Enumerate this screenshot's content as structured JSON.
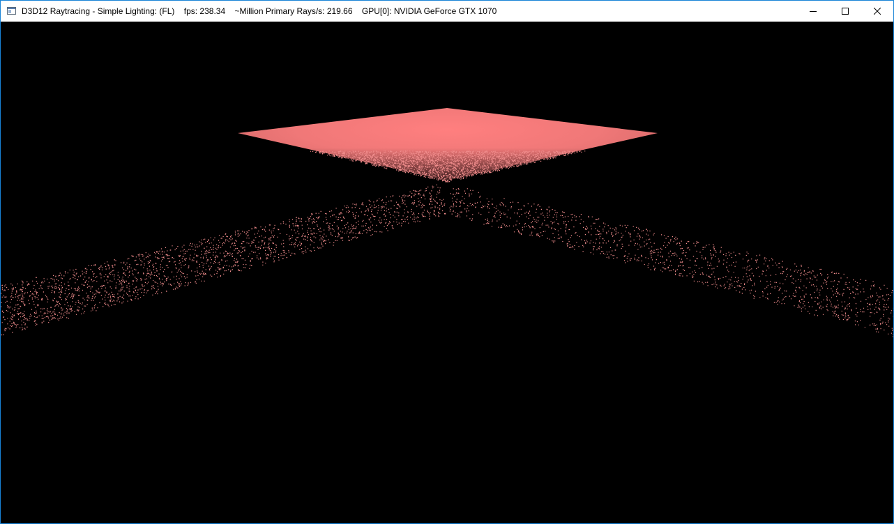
{
  "window": {
    "title": "D3D12 Raytracing - Simple Lighting: (FL)    fps: 238.34    ~Million Primary Rays/s: 219.66    GPU[0]: NVIDIA GeForce GTX 1070",
    "app_icon": "window-app-icon",
    "controls": {
      "minimize_icon": "minimize-icon",
      "maximize_icon": "maximize-icon",
      "close_icon": "close-icon"
    }
  },
  "scene": {
    "background_color": "#000000",
    "surface_color": "#ff7a7a",
    "noise_color": "#f08c8c"
  }
}
